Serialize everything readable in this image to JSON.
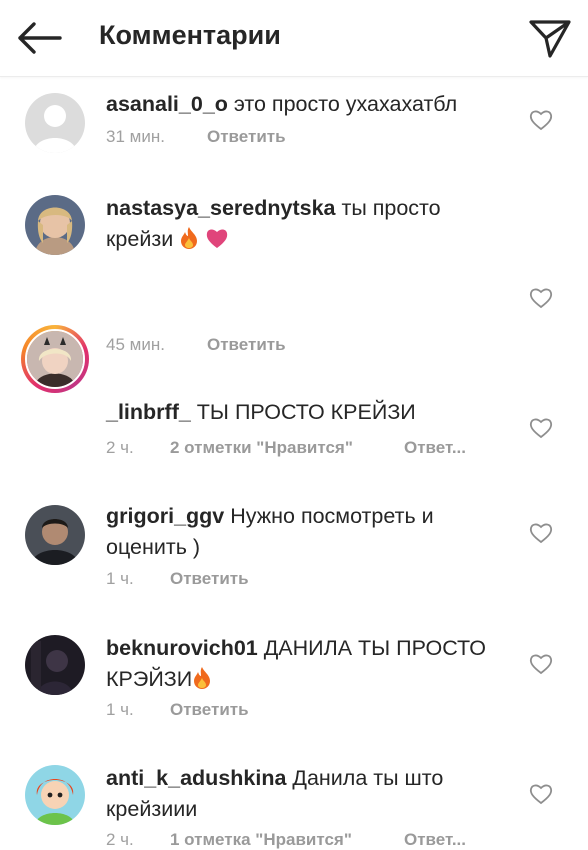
{
  "header": {
    "title": "Комментарии",
    "back_icon": "arrow-left-icon",
    "send_icon": "paper-plane-icon"
  },
  "colors": {
    "text": "#262626",
    "meta": "#a0a0a0",
    "heart_emoji": "#e0457b",
    "fire_emoji": "#f06a1d"
  },
  "comments": [
    {
      "username": "asanali_0_o",
      "text": " это просто ухахахатбл",
      "time": "31 мин.",
      "likes": "",
      "reply": "Ответить"
    },
    {
      "username": "nastasya_serednytska",
      "text": " ты просто крейзи ",
      "time": "45 мин.",
      "likes": "",
      "reply": "Ответить"
    },
    {
      "username": "_linbrff_",
      "text": " ТЫ ПРОСТО КРЕЙЗИ",
      "time": "2 ч.",
      "likes": "2 отметки \"Нравится\"",
      "reply": "Ответ..."
    },
    {
      "username": "grigori_ggv",
      "text": " Нужно посмотреть и оценить )",
      "time": "1 ч.",
      "likes": "",
      "reply": "Ответить"
    },
    {
      "username": "beknurovich01",
      "text": " ДАНИЛА ТЫ ПРОСТО КРЭЙЗИ",
      "time": "1 ч.",
      "likes": "",
      "reply": "Ответить"
    },
    {
      "username": "anti_k_adushkina",
      "text": " Данила ты што крейзиии",
      "time": "2 ч.",
      "likes": "1 отметка \"Нравится\"",
      "reply": "Ответ..."
    }
  ]
}
